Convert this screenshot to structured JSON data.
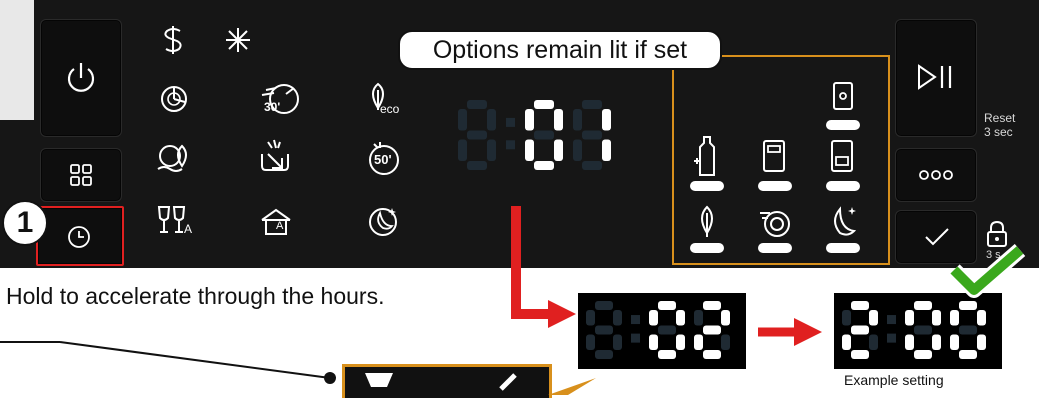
{
  "callout": {
    "text": "Options remain lit if set"
  },
  "step": {
    "number": "1"
  },
  "side_right": {
    "reset": "Reset",
    "reset_sub": "3 sec",
    "lock_sub": "3 s"
  },
  "instruction": {
    "text": "Hold to accelerate through the hours."
  },
  "example": {
    "text": "Example setting"
  },
  "icons": {
    "power": "power-icon",
    "grid": "grid-icon",
    "delay": "clock-icon",
    "play_pause": "play-pause-icon",
    "more": "more-icon",
    "confirm": "check-icon",
    "lock": "lock-icon"
  },
  "option_labels": {
    "eco": "eco",
    "t30": "30'",
    "t50": "50'",
    "a": "A"
  },
  "display": {
    "main": "0:01",
    "step2": "0:02",
    "step3": "2:00"
  },
  "colors": {
    "panel": "#161616",
    "accent_orange": "#d8901c",
    "red": "#e02020",
    "green": "#3aa81c",
    "lcd_dim": "#1f2a33"
  }
}
